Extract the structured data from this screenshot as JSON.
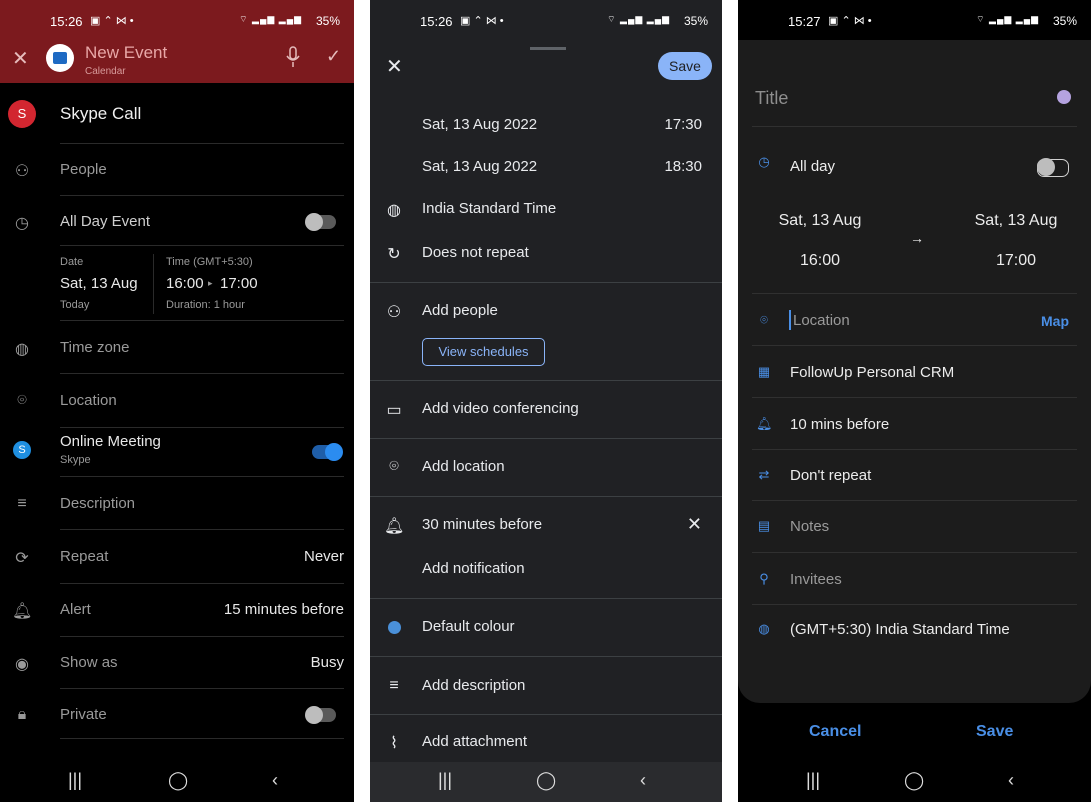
{
  "phone1": {
    "status": {
      "time": "15:26",
      "battery": "35%"
    },
    "appbar": {
      "title": "New Event",
      "subtitle": "Calendar"
    },
    "event_title": "Skype Call",
    "people": "People",
    "all_day": "All Day Event",
    "date_label": "Date",
    "date_value": "Sat, 13 Aug",
    "date_sub": "Today",
    "time_label": "Time (GMT+5:30)",
    "time_start": "16:00",
    "time_end": "17:00",
    "duration": "Duration: 1 hour",
    "time_zone": "Time zone",
    "location": "Location",
    "online_meeting": "Online Meeting",
    "online_sub": "Skype",
    "description": "Description",
    "repeat": {
      "label": "Repeat",
      "value": "Never"
    },
    "alert": {
      "label": "Alert",
      "value": "15 minutes before"
    },
    "show_as": {
      "label": "Show as",
      "value": "Busy"
    },
    "private": "Private"
  },
  "phone2": {
    "status": {
      "time": "15:26",
      "battery": "35%"
    },
    "save": "Save",
    "start_date": "Sat, 13 Aug 2022",
    "start_time": "17:30",
    "end_date": "Sat, 13 Aug 2022",
    "end_time": "18:30",
    "timezone": "India Standard Time",
    "repeat": "Does not repeat",
    "add_people": "Add people",
    "view_schedules": "View schedules",
    "video": "Add video conferencing",
    "location": "Add location",
    "notification": "30 minutes before",
    "add_notification": "Add notification",
    "colour": "Default colour",
    "description": "Add description",
    "attachment": "Add attachment"
  },
  "phone3": {
    "status": {
      "time": "15:27",
      "battery": "35%"
    },
    "title_placeholder": "Title",
    "all_day": "All day",
    "start_date": "Sat, 13 Aug",
    "start_time": "16:00",
    "end_date": "Sat, 13 Aug",
    "end_time": "17:00",
    "location_placeholder": "Location",
    "map": "Map",
    "calendar": "FollowUp Personal CRM",
    "reminder": "10 mins before",
    "repeat": "Don't repeat",
    "notes": "Notes",
    "invitees": "Invitees",
    "timezone": "(GMT+5:30) India Standard Time",
    "cancel": "Cancel",
    "save": "Save"
  }
}
